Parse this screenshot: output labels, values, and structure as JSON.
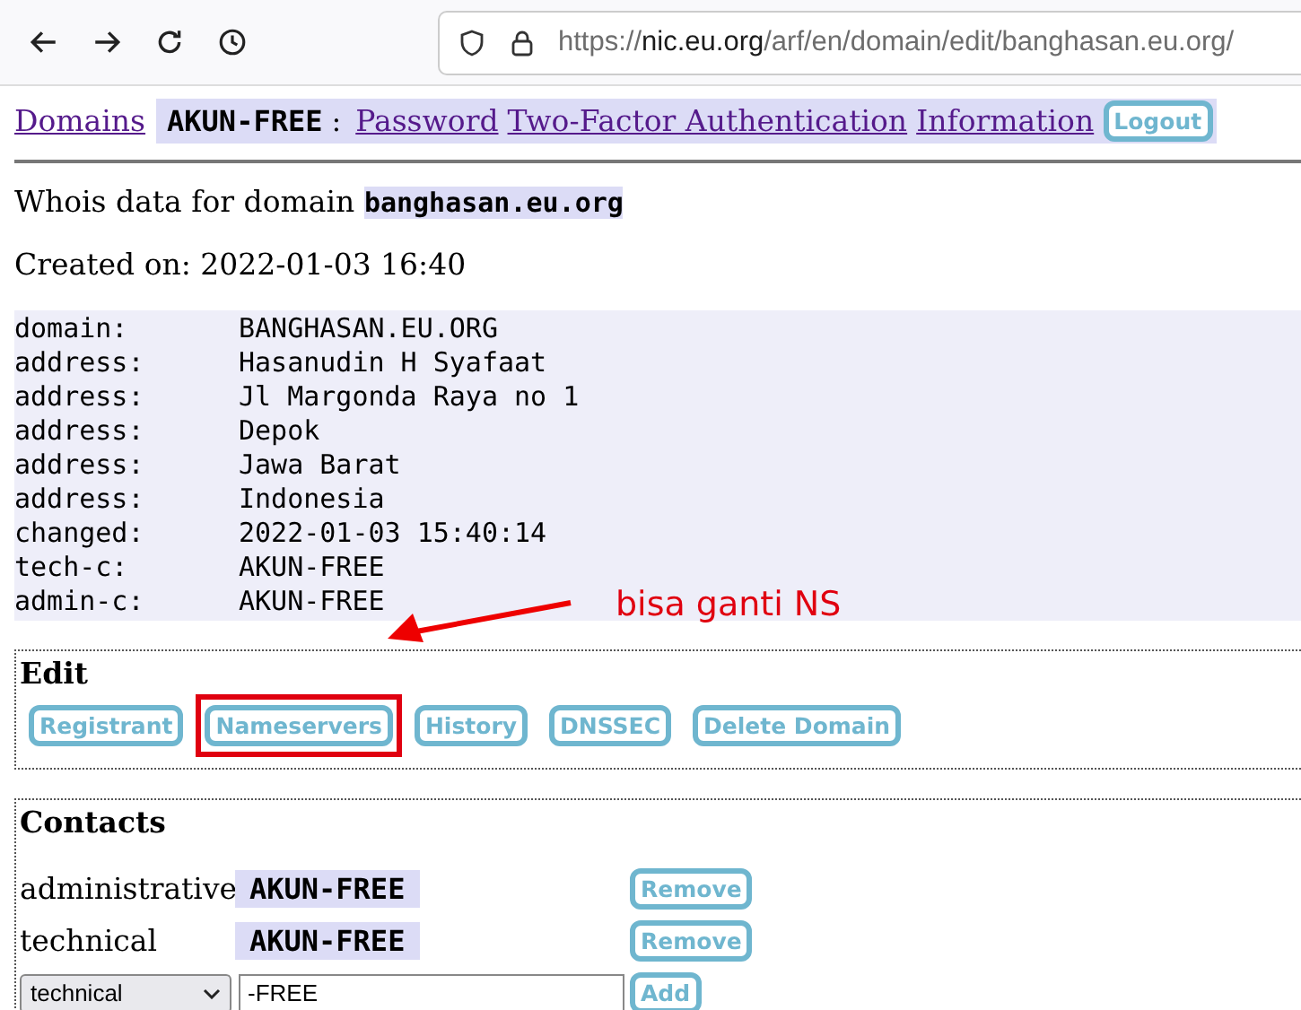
{
  "browser": {
    "url_scheme": "https://",
    "url_host": "nic.eu.org",
    "url_path": "/arf/en/domain/edit/banghasan.eu.org/"
  },
  "nav": {
    "links": [
      "Domains"
    ],
    "handle": "AKUN-FREE",
    "separator": ":",
    "account_links": [
      "Password",
      "Two-Factor Authentication",
      "Information"
    ],
    "logout": "Logout"
  },
  "whois_heading": {
    "text": "Whois data for domain",
    "domain": "banghasan.eu.org"
  },
  "created": "Created on: 2022-01-03 16:40",
  "whois": [
    {
      "key": "domain:",
      "value": "BANGHASAN.EU.ORG"
    },
    {
      "key": "address:",
      "value": "Hasanudin H Syafaat"
    },
    {
      "key": "address:",
      "value": "Jl Margonda Raya no 1"
    },
    {
      "key": "address:",
      "value": "Depok"
    },
    {
      "key": "address:",
      "value": "Jawa Barat"
    },
    {
      "key": "address:",
      "value": "Indonesia"
    },
    {
      "key": "changed:",
      "value": "2022-01-03 15:40:14"
    },
    {
      "key": "tech-c:",
      "value": "AKUN-FREE"
    },
    {
      "key": "admin-c:",
      "value": "AKUN-FREE"
    }
  ],
  "edit": {
    "title": "Edit",
    "buttons": [
      {
        "label": "Registrant",
        "highlighted": false
      },
      {
        "label": "Nameservers",
        "highlighted": true
      },
      {
        "label": "History",
        "highlighted": false
      },
      {
        "label": "DNSSEC",
        "highlighted": false
      },
      {
        "label": "Delete Domain",
        "highlighted": false
      }
    ]
  },
  "contacts": {
    "title": "Contacts",
    "rows": [
      {
        "role": "administrative",
        "handle": "AKUN-FREE",
        "button": "Remove"
      },
      {
        "role": "technical",
        "handle": "AKUN-FREE",
        "button": "Remove"
      }
    ],
    "add": {
      "select": "technical",
      "value": "-FREE",
      "button": "Add"
    }
  },
  "annotation": {
    "text": "bisa ganti NS"
  }
}
